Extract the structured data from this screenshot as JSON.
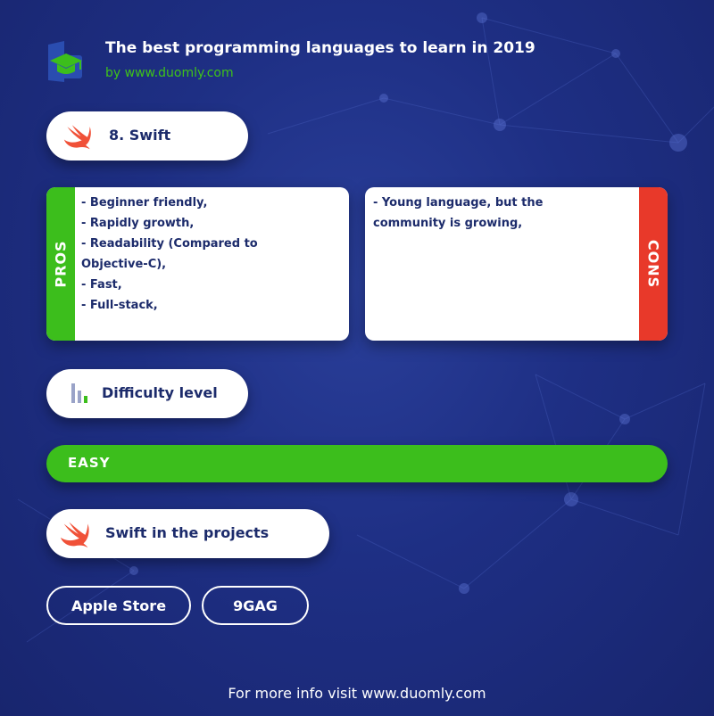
{
  "header": {
    "title": "The best programming languages to learn in 2019",
    "subtitle": "by www.duomly.com"
  },
  "language": {
    "heading": "8. Swift",
    "icon": "swift-logo-icon"
  },
  "pros": {
    "band_label": "PROS",
    "items": [
      "- Beginner friendly,",
      "- Rapidly growth,",
      "- Readability (Compared to",
      "Objective-C),",
      "- Fast,",
      "- Full-stack,"
    ]
  },
  "cons": {
    "band_label": "CONS",
    "items": [
      "- Young language, but the",
      "community is growing,"
    ]
  },
  "difficulty": {
    "heading": "Difficulty level",
    "icon": "bar-chart-icon",
    "level": "EASY"
  },
  "projects": {
    "heading": "Swift in the projects",
    "icon": "swift-logo-icon",
    "items": [
      "Apple Store",
      "9GAG"
    ]
  },
  "footer": {
    "text": "For more info visit www.duomly.com"
  },
  "colors": {
    "background": "#1e2f84",
    "accent_green": "#3cbe1c",
    "accent_red": "#e8392a",
    "text_dark": "#1c2b6b",
    "swift_orange": "#f05138"
  }
}
